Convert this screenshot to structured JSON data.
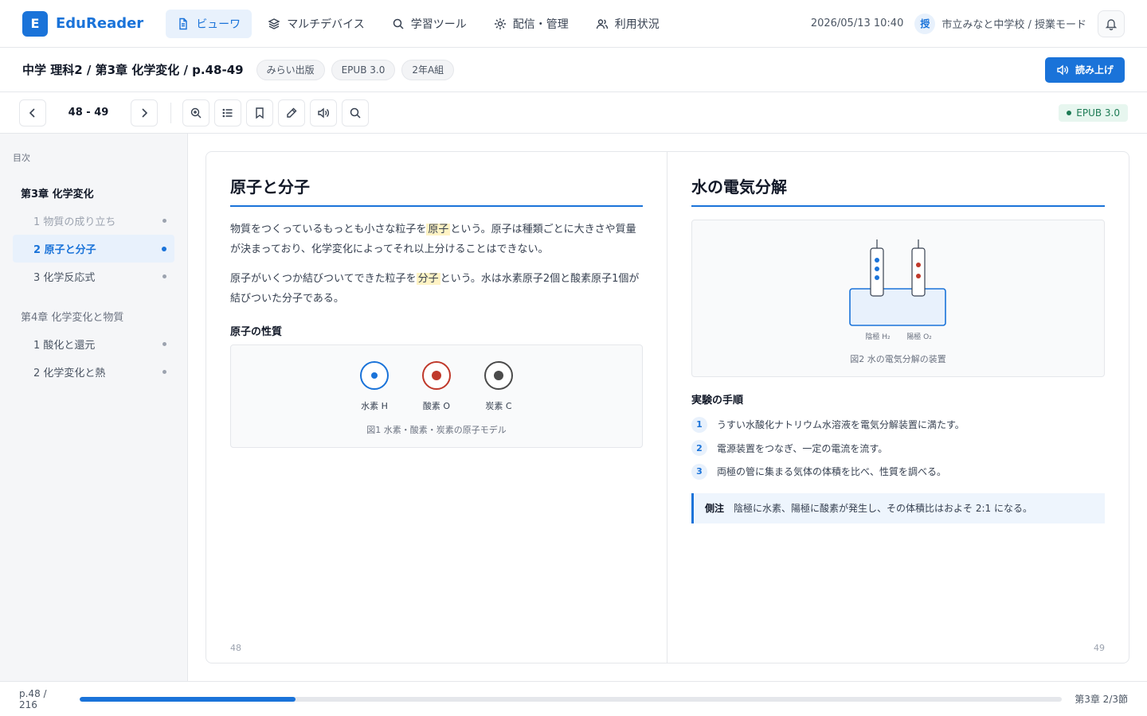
{
  "app": {
    "logo_letter": "E",
    "name": "EduReader"
  },
  "nav": {
    "tabs": [
      {
        "label": "ビューワ",
        "icon": "document-icon",
        "active": true
      },
      {
        "label": "マルチデバイス",
        "icon": "layers-icon",
        "active": false
      },
      {
        "label": "学習ツール",
        "icon": "search-icon",
        "active": false
      },
      {
        "label": "配信・管理",
        "icon": "gear-icon",
        "active": false
      },
      {
        "label": "利用状況",
        "icon": "users-icon",
        "active": false
      }
    ],
    "datetime": "2026/05/13 10:40",
    "mode_badge": "授",
    "school": "市立みなと中学校 / 授業モード"
  },
  "titlebar": {
    "book_title": "中学 理科2 / 第3章 化学変化 / p.48-49",
    "chips": [
      "みらい出版",
      "EPUB 3.0",
      "2年A組"
    ],
    "read_aloud_label": "読み上げ"
  },
  "toolbar": {
    "page_indicator": "48 - 49",
    "format_badge": "EPUB 3.0"
  },
  "toc": {
    "label": "目次",
    "chapters": [
      {
        "title": "第3章 化学変化",
        "current": true,
        "items": [
          {
            "label": "1 物質の成り立ち",
            "state": "done"
          },
          {
            "label": "2 原子と分子",
            "state": "active"
          },
          {
            "label": "3 化学反応式",
            "state": "normal"
          }
        ]
      },
      {
        "title": "第4章 化学変化と物質",
        "current": false,
        "items": [
          {
            "label": "1 酸化と還元",
            "state": "normal"
          },
          {
            "label": "2 化学変化と熱",
            "state": "normal"
          }
        ]
      }
    ]
  },
  "left_page": {
    "heading": "原子と分子",
    "p1": {
      "a": "物質をつくっているもっとも小さな粒子を",
      "hl": "原子",
      "b": "という。原子は種類ごとに大きさや質量が決まっており、化学変化によってそれ以上分けることはできない。"
    },
    "p2": {
      "a": "原子がいくつか結びついてできた粒子を",
      "hl": "分子",
      "b": "という。水は水素原子2個と酸素原子1個が結びついた分子である。"
    },
    "subheading": "原子の性質",
    "atoms": [
      {
        "name": "水素 H",
        "color": "#1a73d9"
      },
      {
        "name": "酸素 O",
        "color": "#c0392b"
      },
      {
        "name": "炭素 C",
        "color": "#4b4b4b"
      }
    ],
    "figure_caption": "図1 水素・酸素・炭素の原子モデル",
    "page_number": "48"
  },
  "right_page": {
    "heading": "水の電気分解",
    "electrode_labels": [
      "陰極 H₂",
      "陽極 O₂"
    ],
    "figure_caption": "図2 水の電気分解の装置",
    "steps_heading": "実験の手順",
    "steps": [
      {
        "num": "1",
        "text": "うすい水酸化ナトリウム水溶液を電気分解装置に満たす。"
      },
      {
        "num": "2",
        "text": "電源装置をつなぎ、一定の電流を流す。"
      },
      {
        "num": "3",
        "text": "両極の管に集まる気体の体積を比べ、性質を調べる。"
      }
    ],
    "note_label": "側注",
    "note_text": "陰極に水素、陽極に酸素が発生し、その体積比はおよそ 2:1 になる。",
    "page_number": "49"
  },
  "footer": {
    "page_status": "p.48 / 216",
    "progress": 0.22,
    "section_status": "第3章 2/3節"
  }
}
